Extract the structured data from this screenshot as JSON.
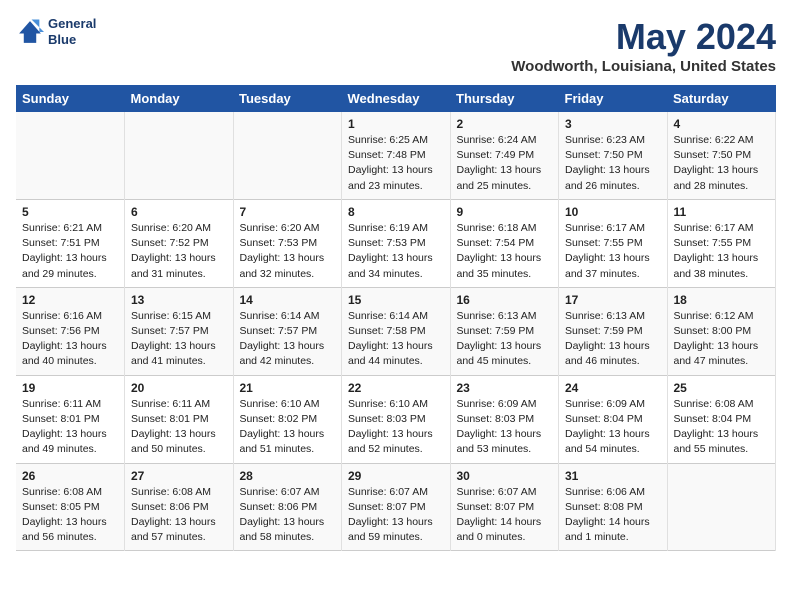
{
  "header": {
    "logo_line1": "General",
    "logo_line2": "Blue",
    "month": "May 2024",
    "location": "Woodworth, Louisiana, United States"
  },
  "weekdays": [
    "Sunday",
    "Monday",
    "Tuesday",
    "Wednesday",
    "Thursday",
    "Friday",
    "Saturday"
  ],
  "weeks": [
    [
      {
        "day": "",
        "info": ""
      },
      {
        "day": "",
        "info": ""
      },
      {
        "day": "",
        "info": ""
      },
      {
        "day": "1",
        "info": "Sunrise: 6:25 AM\nSunset: 7:48 PM\nDaylight: 13 hours\nand 23 minutes."
      },
      {
        "day": "2",
        "info": "Sunrise: 6:24 AM\nSunset: 7:49 PM\nDaylight: 13 hours\nand 25 minutes."
      },
      {
        "day": "3",
        "info": "Sunrise: 6:23 AM\nSunset: 7:50 PM\nDaylight: 13 hours\nand 26 minutes."
      },
      {
        "day": "4",
        "info": "Sunrise: 6:22 AM\nSunset: 7:50 PM\nDaylight: 13 hours\nand 28 minutes."
      }
    ],
    [
      {
        "day": "5",
        "info": "Sunrise: 6:21 AM\nSunset: 7:51 PM\nDaylight: 13 hours\nand 29 minutes."
      },
      {
        "day": "6",
        "info": "Sunrise: 6:20 AM\nSunset: 7:52 PM\nDaylight: 13 hours\nand 31 minutes."
      },
      {
        "day": "7",
        "info": "Sunrise: 6:20 AM\nSunset: 7:53 PM\nDaylight: 13 hours\nand 32 minutes."
      },
      {
        "day": "8",
        "info": "Sunrise: 6:19 AM\nSunset: 7:53 PM\nDaylight: 13 hours\nand 34 minutes."
      },
      {
        "day": "9",
        "info": "Sunrise: 6:18 AM\nSunset: 7:54 PM\nDaylight: 13 hours\nand 35 minutes."
      },
      {
        "day": "10",
        "info": "Sunrise: 6:17 AM\nSunset: 7:55 PM\nDaylight: 13 hours\nand 37 minutes."
      },
      {
        "day": "11",
        "info": "Sunrise: 6:17 AM\nSunset: 7:55 PM\nDaylight: 13 hours\nand 38 minutes."
      }
    ],
    [
      {
        "day": "12",
        "info": "Sunrise: 6:16 AM\nSunset: 7:56 PM\nDaylight: 13 hours\nand 40 minutes."
      },
      {
        "day": "13",
        "info": "Sunrise: 6:15 AM\nSunset: 7:57 PM\nDaylight: 13 hours\nand 41 minutes."
      },
      {
        "day": "14",
        "info": "Sunrise: 6:14 AM\nSunset: 7:57 PM\nDaylight: 13 hours\nand 42 minutes."
      },
      {
        "day": "15",
        "info": "Sunrise: 6:14 AM\nSunset: 7:58 PM\nDaylight: 13 hours\nand 44 minutes."
      },
      {
        "day": "16",
        "info": "Sunrise: 6:13 AM\nSunset: 7:59 PM\nDaylight: 13 hours\nand 45 minutes."
      },
      {
        "day": "17",
        "info": "Sunrise: 6:13 AM\nSunset: 7:59 PM\nDaylight: 13 hours\nand 46 minutes."
      },
      {
        "day": "18",
        "info": "Sunrise: 6:12 AM\nSunset: 8:00 PM\nDaylight: 13 hours\nand 47 minutes."
      }
    ],
    [
      {
        "day": "19",
        "info": "Sunrise: 6:11 AM\nSunset: 8:01 PM\nDaylight: 13 hours\nand 49 minutes."
      },
      {
        "day": "20",
        "info": "Sunrise: 6:11 AM\nSunset: 8:01 PM\nDaylight: 13 hours\nand 50 minutes."
      },
      {
        "day": "21",
        "info": "Sunrise: 6:10 AM\nSunset: 8:02 PM\nDaylight: 13 hours\nand 51 minutes."
      },
      {
        "day": "22",
        "info": "Sunrise: 6:10 AM\nSunset: 8:03 PM\nDaylight: 13 hours\nand 52 minutes."
      },
      {
        "day": "23",
        "info": "Sunrise: 6:09 AM\nSunset: 8:03 PM\nDaylight: 13 hours\nand 53 minutes."
      },
      {
        "day": "24",
        "info": "Sunrise: 6:09 AM\nSunset: 8:04 PM\nDaylight: 13 hours\nand 54 minutes."
      },
      {
        "day": "25",
        "info": "Sunrise: 6:08 AM\nSunset: 8:04 PM\nDaylight: 13 hours\nand 55 minutes."
      }
    ],
    [
      {
        "day": "26",
        "info": "Sunrise: 6:08 AM\nSunset: 8:05 PM\nDaylight: 13 hours\nand 56 minutes."
      },
      {
        "day": "27",
        "info": "Sunrise: 6:08 AM\nSunset: 8:06 PM\nDaylight: 13 hours\nand 57 minutes."
      },
      {
        "day": "28",
        "info": "Sunrise: 6:07 AM\nSunset: 8:06 PM\nDaylight: 13 hours\nand 58 minutes."
      },
      {
        "day": "29",
        "info": "Sunrise: 6:07 AM\nSunset: 8:07 PM\nDaylight: 13 hours\nand 59 minutes."
      },
      {
        "day": "30",
        "info": "Sunrise: 6:07 AM\nSunset: 8:07 PM\nDaylight: 14 hours\nand 0 minutes."
      },
      {
        "day": "31",
        "info": "Sunrise: 6:06 AM\nSunset: 8:08 PM\nDaylight: 14 hours\nand 1 minute."
      },
      {
        "day": "",
        "info": ""
      }
    ]
  ]
}
